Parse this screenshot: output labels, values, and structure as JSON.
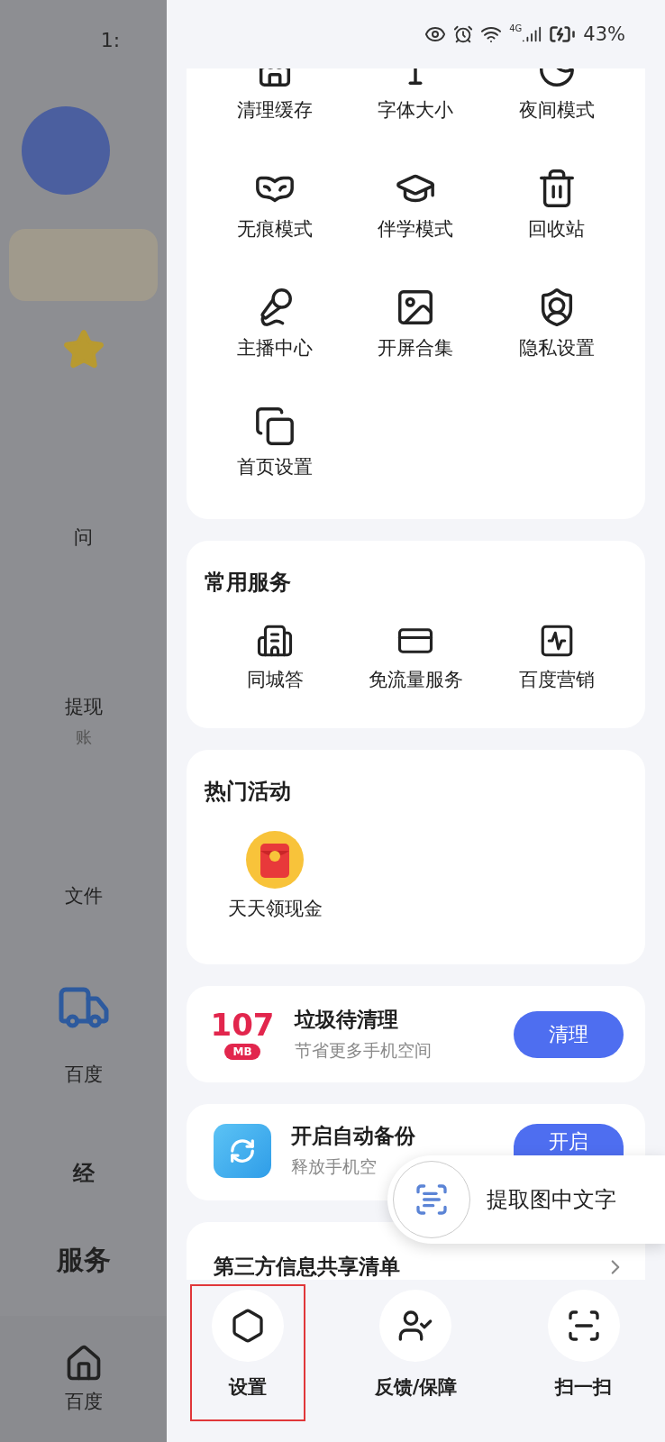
{
  "status_bar": {
    "time": "1:",
    "network": "4G",
    "battery": "43%"
  },
  "background_page": {
    "texts": [
      {
        "kind": "fragment",
        "text": "问"
      },
      {
        "kind": "fragment",
        "text": "提现"
      },
      {
        "kind": "sub",
        "text": "账"
      },
      {
        "kind": "fragment",
        "text": "文件"
      },
      {
        "kind": "fragment",
        "text": "百度"
      },
      {
        "kind": "section",
        "text": "经"
      },
      {
        "kind": "heading",
        "text": "服务"
      }
    ],
    "tab": "百度"
  },
  "tools": {
    "items": [
      {
        "label": "清理缓存"
      },
      {
        "label": "字体大小"
      },
      {
        "label": "夜间模式"
      },
      {
        "label": "无痕模式"
      },
      {
        "label": "伴学模式"
      },
      {
        "label": "回收站"
      },
      {
        "label": "主播中心"
      },
      {
        "label": "开屏合集"
      },
      {
        "label": "隐私设置"
      },
      {
        "label": "首页设置"
      }
    ]
  },
  "common_services": {
    "title": "常用服务",
    "items": [
      {
        "label": "同城答"
      },
      {
        "label": "免流量服务"
      },
      {
        "label": "百度营销"
      }
    ]
  },
  "hot_activities": {
    "title": "热门活动",
    "items": [
      {
        "label": "天天领现金"
      }
    ]
  },
  "cleanup": {
    "size": "107",
    "unit": "MB",
    "title": "垃圾待清理",
    "subtitle": "节省更多手机空间",
    "button": "清理"
  },
  "backup": {
    "title": "开启自动备份",
    "subtitle": "释放手机空",
    "button": "开启"
  },
  "third_party": {
    "title": "第三方信息共享清单"
  },
  "text_popup": {
    "label": "提取图中文字"
  },
  "bottom_actions": [
    {
      "label": "设置",
      "highlighted": true
    },
    {
      "label": "反馈/保障",
      "highlighted": false
    },
    {
      "label": "扫一扫",
      "highlighted": false
    }
  ]
}
